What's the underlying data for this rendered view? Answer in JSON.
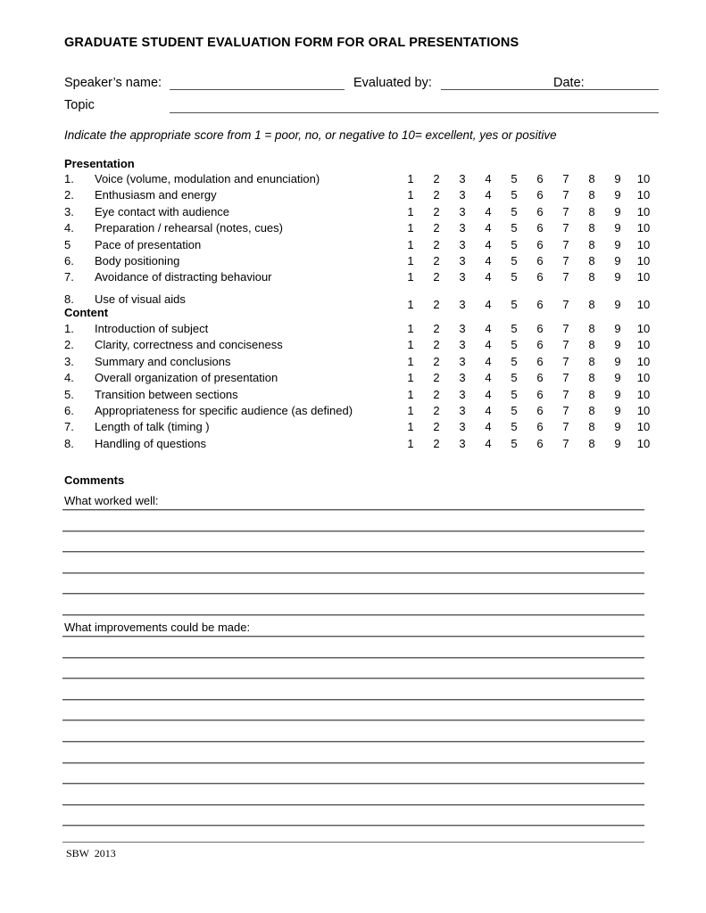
{
  "document": {
    "title": "GRADUATE STUDENT EVALUATION FORM FOR ORAL PRESENTATIONS",
    "footer": "SBW  2013"
  },
  "header": {
    "speaker_label": "Speaker’s name:",
    "evaluated_by_label": "Evaluated by:",
    "date_label": "Date:",
    "topic_label": "Topic",
    "speaker_value": "",
    "evaluated_by_value": "",
    "date_value": "",
    "topic_value": ""
  },
  "instruction": "Indicate the appropriate score from 1 = poor, no, or negative to 10= excellent, yes or positive",
  "scale": {
    "values": [
      "1",
      "2",
      "3",
      "4",
      "5",
      "6",
      "7",
      "8",
      "9",
      "10"
    ],
    "min_label": "1 = poor, no, or negative",
    "max_label": "10= excellent, yes or positive"
  },
  "sections": [
    {
      "heading": "Presentation",
      "items": [
        {
          "number": "1.",
          "label": "Voice (volume, modulation and enunciation)"
        },
        {
          "number": "2.",
          "label": "Enthusiasm and energy"
        },
        {
          "number": "3.",
          "label": "Eye contact with audience"
        },
        {
          "number": "4.",
          "label": "Preparation / rehearsal (notes, cues)"
        },
        {
          "number": "5",
          "label": "Pace of presentation"
        },
        {
          "number": "6.",
          "label": "Body positioning"
        },
        {
          "number": "7.",
          "label": "Avoidance of distracting behaviour"
        },
        {
          "number": "8.",
          "label": "Use of visual aids"
        }
      ]
    },
    {
      "heading": "Content",
      "items": [
        {
          "number": "1.",
          "label": "Introduction of subject"
        },
        {
          "number": "2.",
          "label": "Clarity, correctness and conciseness"
        },
        {
          "number": "3.",
          "label": "Summary and conclusions"
        },
        {
          "number": "4.",
          "label": "Overall organization of presentation"
        },
        {
          "number": "5.",
          "label": "Transition between sections"
        },
        {
          "number": "6.",
          "label": "Appropriateness for specific audience (as defined)"
        },
        {
          "number": "7.",
          "label": "Length of talk (timing )"
        },
        {
          "number": "8.",
          "label": "Handling of questions"
        }
      ]
    }
  ],
  "comments": {
    "heading": "Comments",
    "blocks": [
      {
        "label": "What worked well:",
        "lines": 5
      },
      {
        "label": "What improvements could be made:",
        "lines": 9
      }
    ]
  }
}
